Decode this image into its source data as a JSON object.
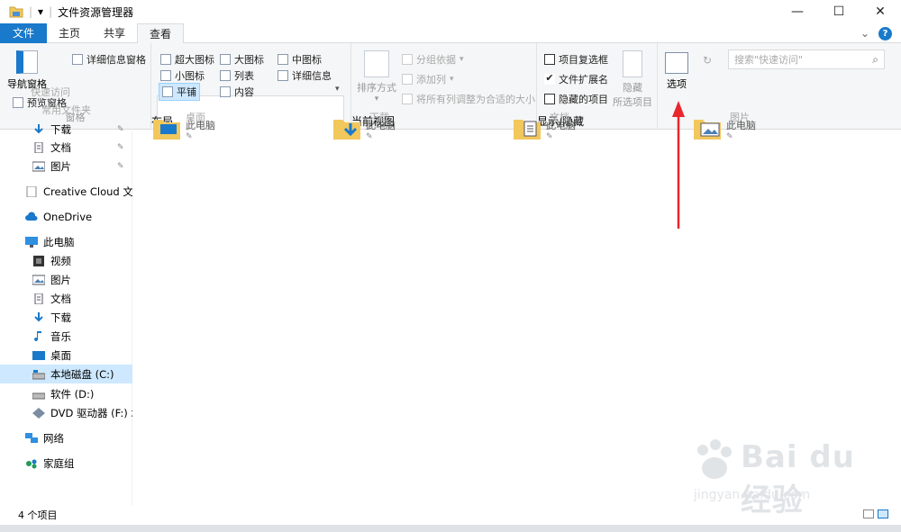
{
  "window": {
    "title": "文件资源管理器",
    "qat_dropdown": "▾",
    "minimize": "—",
    "maximize": "☐",
    "close": "✕"
  },
  "tabs": {
    "file": "文件",
    "home": "主页",
    "share": "共享",
    "view": "查看",
    "expand": "⌄",
    "help": "?"
  },
  "ribbon": {
    "pane": {
      "nav_pane": "导航窗格",
      "preview_pane": "预览窗格",
      "details_pane": "详细信息窗格",
      "label": "窗格"
    },
    "layout": {
      "extra_large": "超大图标",
      "large": "大图标",
      "medium": "中图标",
      "small": "小图标",
      "list": "列表",
      "details": "详细信息",
      "tiles": "平铺",
      "content": "内容",
      "label": "布局"
    },
    "current_view": {
      "sort_by": "排序方式",
      "group_by": "分组依据",
      "add_columns": "添加列",
      "size_all_columns": "将所有列调整为合适的大小",
      "label": "当前视图"
    },
    "show_hide": {
      "item_checkboxes": "项目复选框",
      "file_extensions": "文件扩展名",
      "hidden_items": "隐藏的项目",
      "hide_selected": "隐藏",
      "hide_selected_2": "所选项目",
      "label": "显示/隐藏",
      "file_extensions_checked": "✔"
    },
    "options": "选项"
  },
  "address": {
    "back_hint": "快速访问",
    "search_placeholder": "搜索\"快速访问\""
  },
  "ghost_labels": {
    "quick_access": "快速访问",
    "frequent": "常用文件夹",
    "desktop": "桌面",
    "downloads": "下载",
    "documents": "文档",
    "pictures": "图片"
  },
  "sidebar": {
    "items": [
      {
        "label": "下载",
        "pin": "📌"
      },
      {
        "label": "文档",
        "pin": "📌"
      },
      {
        "label": "图片",
        "pin": "📌"
      },
      {
        "label": "Creative Cloud 文件"
      },
      {
        "label": "OneDrive"
      },
      {
        "label": "此电脑"
      },
      {
        "label": "视频"
      },
      {
        "label": "图片"
      },
      {
        "label": "文档"
      },
      {
        "label": "下载"
      },
      {
        "label": "音乐"
      },
      {
        "label": "桌面"
      },
      {
        "label": "本地磁盘 (C:)"
      },
      {
        "label": "软件 (D:)"
      },
      {
        "label": "DVD 驱动器 (F:) 北"
      },
      {
        "label": "网络"
      },
      {
        "label": "家庭组"
      }
    ]
  },
  "tiles": [
    {
      "name": "桌面",
      "location": "此电脑"
    },
    {
      "name": "下载",
      "location": "此电脑"
    },
    {
      "name": "文档",
      "location": "此电脑"
    },
    {
      "name": "图片",
      "location": "此电脑"
    }
  ],
  "status": {
    "count": "4 个项目"
  },
  "watermark": {
    "brand": "Bai du 经验",
    "url": "jingyan.baidu.com"
  },
  "colors": {
    "accent": "#1979ca",
    "selected": "#cde8ff",
    "arrow": "#e8262b"
  }
}
